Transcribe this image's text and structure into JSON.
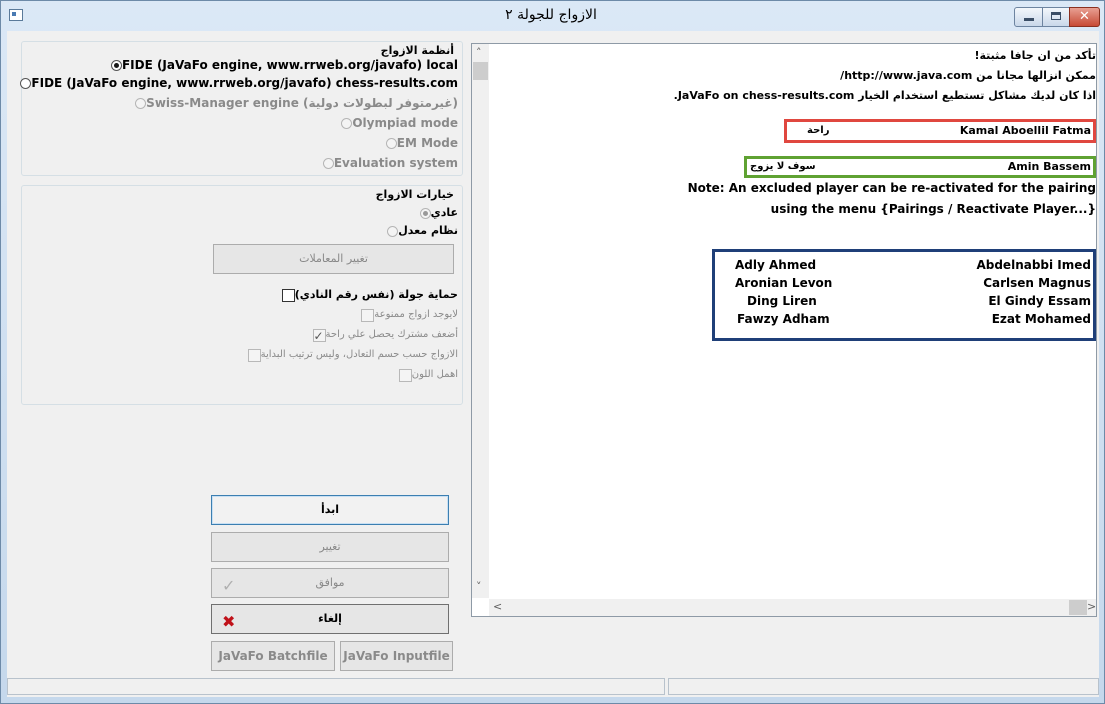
{
  "window": {
    "title": "الازواج للجولة ٢"
  },
  "pairing_systems": {
    "title": "أنظمة الازواج",
    "options": [
      {
        "label": "FIDE (JaVaFo engine, www.rrweb.org/javafo) local",
        "selected": true,
        "enabled": true
      },
      {
        "label": "FIDE (JaVaFo engine, www.rrweb.org/javafo) chess-results.com",
        "selected": false,
        "enabled": true
      },
      {
        "label": "Swiss-Manager engine (غيرمتوفر لبطولات دولية)",
        "selected": false,
        "enabled": false
      },
      {
        "label": "Olympiad mode",
        "selected": false,
        "enabled": false
      },
      {
        "label": "EM Mode",
        "selected": false,
        "enabled": false
      },
      {
        "label": "Evaluation system",
        "selected": false,
        "enabled": false
      }
    ]
  },
  "pairing_options": {
    "title": "خيارات الازواج",
    "modes": [
      {
        "label": "عادي",
        "selected": true
      },
      {
        "label": "نظام معدل",
        "selected": false
      }
    ],
    "change_coefficients_label": "تغيير المعاملات",
    "checkboxes": [
      {
        "label": "حماية جولة (نفس رقم النادي)",
        "checked": false,
        "enabled": true
      },
      {
        "label": "لايوجد ازواج ممنوعة",
        "checked": false,
        "enabled": false
      },
      {
        "label": "أضعف مشترك يحصل علي راحة",
        "checked": true,
        "enabled": false
      },
      {
        "label": "الازواج حسب حسم التعادل، وليس ترتيب البداية",
        "checked": false,
        "enabled": false
      },
      {
        "label": "اهمل اللون",
        "checked": false,
        "enabled": false
      }
    ]
  },
  "buttons": {
    "start": "ابدأ",
    "change": "تغيير",
    "ok": "موافق",
    "cancel": "إلغاء",
    "batchfile": "JaVaFo Batchfile",
    "inputfile": "JaVaFo Inputfile"
  },
  "info": {
    "java_line1": "تأكد من ان جافا مثبتة!",
    "java_line2": "ممكن انزالها مجانا من http://www.java.com/",
    "java_line3": "اذا كان لديك مشاكل تستطيع استخدام الخيار JaVaFo on chess-results.com.",
    "bye_player": "Kamal Aboellil Fatma",
    "bye_label": "راحة",
    "excluded_player": "Amin Bassem",
    "excluded_label": "سوف لا يزوج",
    "note_line1": "Note: An excluded player can be re-activated for the pairing",
    "note_line2": "using the menu {Pairings / Reactivate Player...}"
  },
  "pairings": [
    {
      "white": "Abdelnabbi Imed",
      "black": "Adly Ahmed"
    },
    {
      "white": "Carlsen Magnus",
      "black": "Aronian Levon"
    },
    {
      "white": "El Gindy Essam",
      "black": "Ding Liren"
    },
    {
      "white": "Ezat Mohamed",
      "black": "Fawzy Adham"
    }
  ],
  "colors": {
    "bye_box": "#e0473f",
    "excluded_box": "#5fa232",
    "pairs_box": "#1f3f78",
    "cancel_icon": "#c0121a"
  }
}
